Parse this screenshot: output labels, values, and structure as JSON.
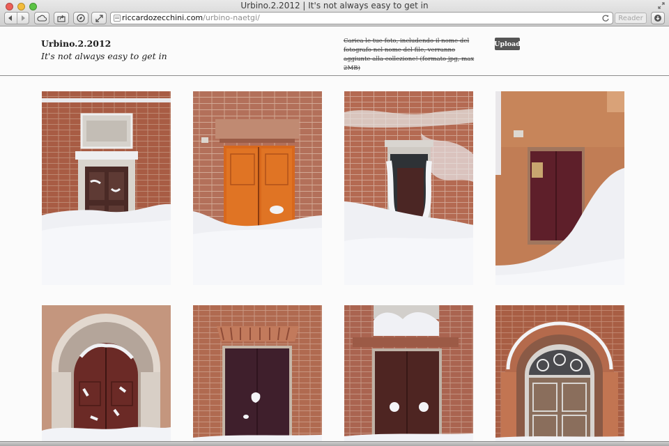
{
  "window": {
    "title": "Urbino.2.2012 | It's not always easy to get in",
    "url_host": "riccardozecchini.com",
    "url_path": "/urbino-naetgi/",
    "reader_label": "Reader"
  },
  "icons": [
    "back-icon",
    "forward-icon",
    "icloud-icon",
    "share-icon",
    "compass-icon",
    "resize-icon",
    "favicon-icon",
    "reload-icon",
    "download-icon",
    "fullscreen-icon"
  ],
  "site": {
    "title": "Urbino.2.2012",
    "tagline": "It's not always easy to get in",
    "upload_note": "Carica le tue foto, includendo il nome del fotografo nel nome del file, verranno aggiunte alla collezione! (formato jpg, max 2MB)",
    "upload_label": "Upload"
  },
  "colors": {
    "brick": "#b5694a",
    "snow": "#f2f3f7",
    "door_orange": "#d8681c",
    "door_dark": "#4a1f22",
    "button": "#555555"
  },
  "photos": [
    {
      "subject": "brick wall with snow-covered marble door frame and dark door",
      "door": "#4a2a26",
      "wall": "#a85c44"
    },
    {
      "subject": "orange wooden door in brick wall, snow drift",
      "door": "#d8681c",
      "wall": "#b3705a"
    },
    {
      "subject": "small dark door behind deep snow bank",
      "door": "#4b2624",
      "wall": "#b46a52"
    },
    {
      "subject": "burgundy door in ochre wall, snow slope",
      "door": "#5e1f2a",
      "wall": "#c17d55"
    },
    {
      "subject": "arched stone doorway with snowy brown door",
      "door": "#6b2a26",
      "wall": "#c4967e"
    },
    {
      "subject": "dark purple door with snow patches in brick wall",
      "door": "#3f1f2c",
      "wall": "#b06a50"
    },
    {
      "subject": "brown double door with snow, snowy ledge above",
      "door": "#4e2522",
      "wall": "#aa6450"
    },
    {
      "subject": "ornate arched door with wrought iron fanlight",
      "door": "#8a6e5c",
      "wall": "#a85e44"
    }
  ]
}
